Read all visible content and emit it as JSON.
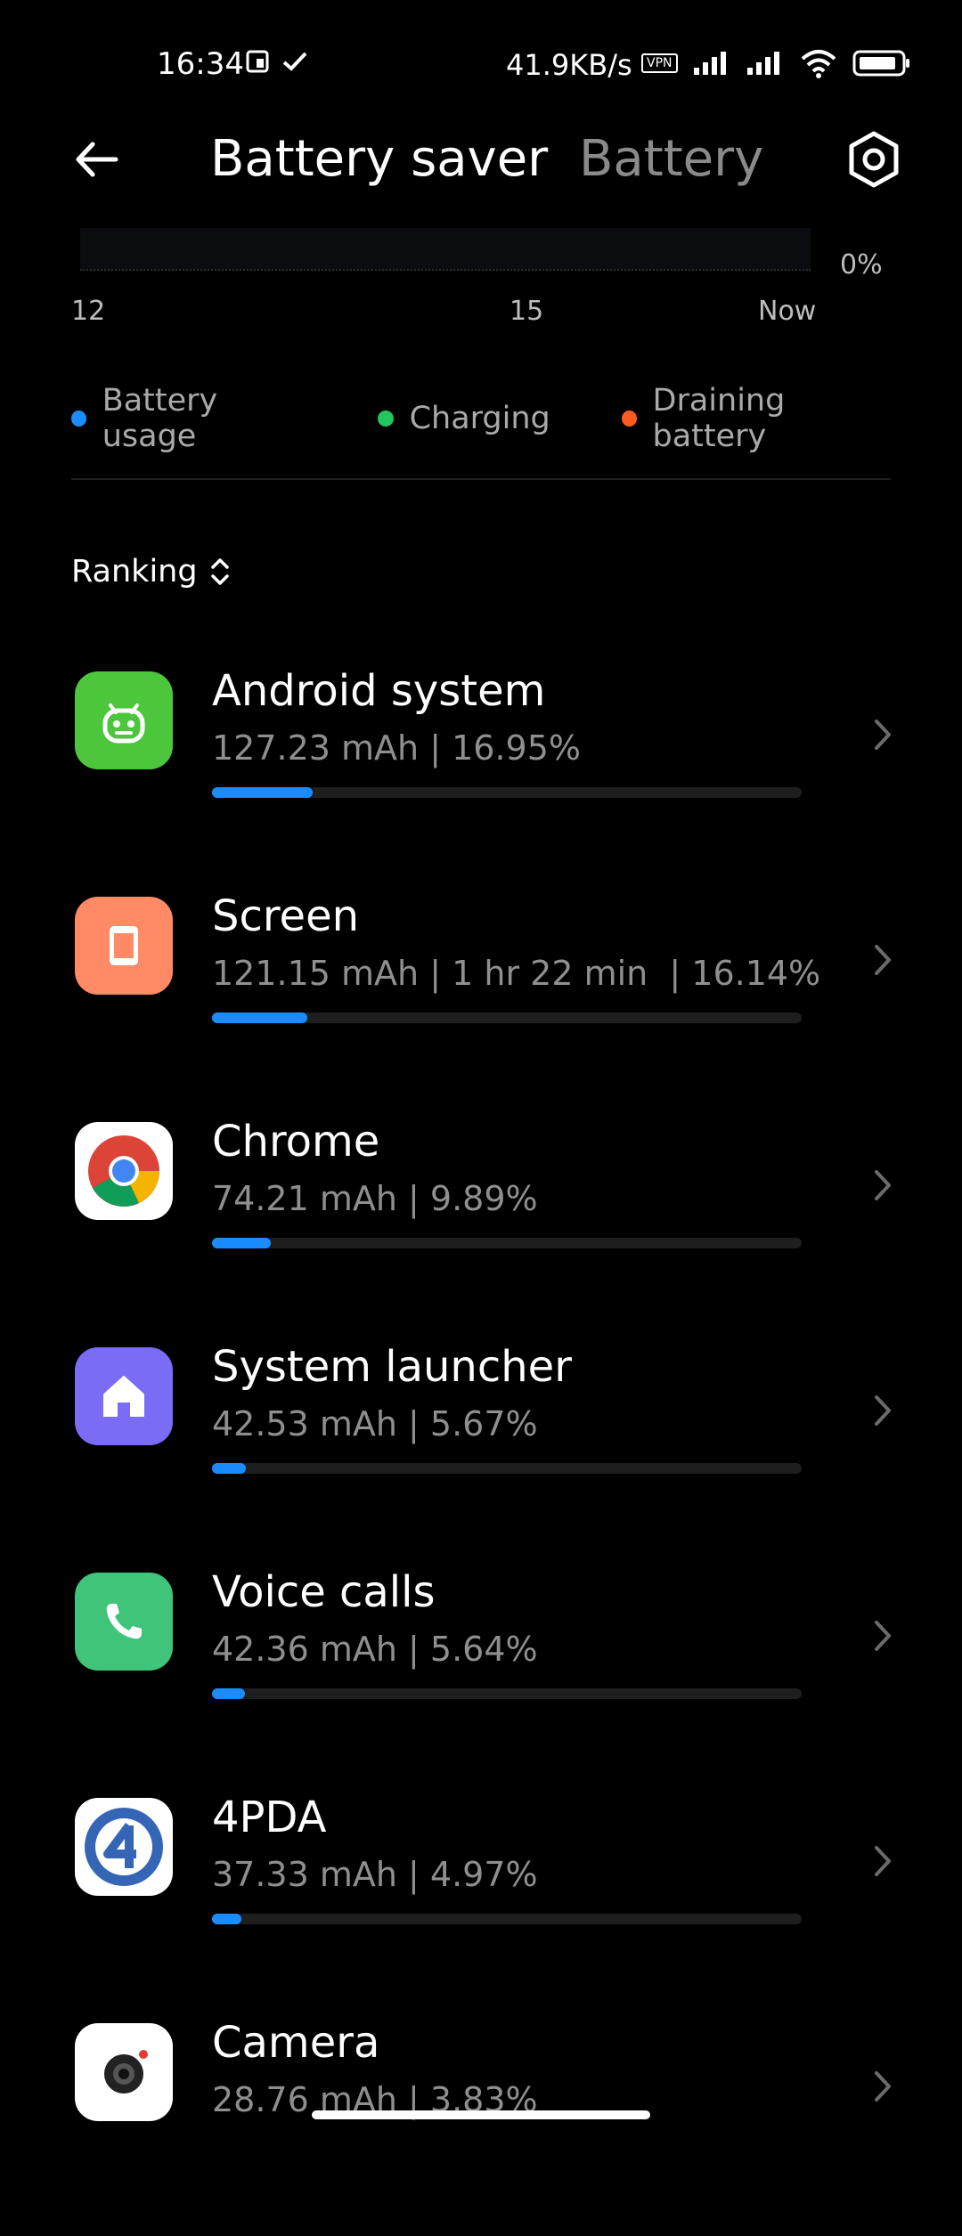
{
  "status_bar": {
    "time": "16:34",
    "speed": "41.9KB/s",
    "vpn": "VPN"
  },
  "header": {
    "title": "Battery saver",
    "tab_battery": "Battery"
  },
  "chart": {
    "percent_label": "0%",
    "x_ticks": [
      "12",
      "15",
      "Now"
    ]
  },
  "legend": [
    {
      "label": "Battery usage",
      "color": "#1a8cff"
    },
    {
      "label": "Charging",
      "color": "#22c55e"
    },
    {
      "label": "Draining battery",
      "color": "#ff5a1f"
    }
  ],
  "ranking": {
    "label": "Ranking"
  },
  "apps": [
    {
      "name": "Android system",
      "sub": "127.23 mAh | 16.95%",
      "usage_percent": 16.95,
      "icon": "android-icon",
      "color": "#4cc63b"
    },
    {
      "name": "Screen",
      "sub": "121.15 mAh | 1 hr 22 min  | 16.14%",
      "usage_percent": 16.14,
      "icon": "screen-icon",
      "color": "#ff8a65"
    },
    {
      "name": "Chrome",
      "sub": "74.21 mAh | 9.89%",
      "usage_percent": 9.89,
      "icon": "chrome-icon",
      "color": "#ffffff"
    },
    {
      "name": "System launcher",
      "sub": "42.53 mAh | 5.67%",
      "usage_percent": 5.67,
      "icon": "home-icon",
      "color": "#7b6cf6"
    },
    {
      "name": "Voice calls",
      "sub": "42.36 mAh | 5.64%",
      "usage_percent": 5.64,
      "icon": "phone-icon",
      "color": "#3fc47a"
    },
    {
      "name": "4PDA",
      "sub": "37.33 mAh | 4.97%",
      "usage_percent": 4.97,
      "icon": "4pda-icon",
      "color": "#ffffff"
    },
    {
      "name": "Camera",
      "sub": "28.76 mAh | 3.83%",
      "usage_percent": 3.83,
      "icon": "camera-icon",
      "color": "#ffffff"
    }
  ]
}
